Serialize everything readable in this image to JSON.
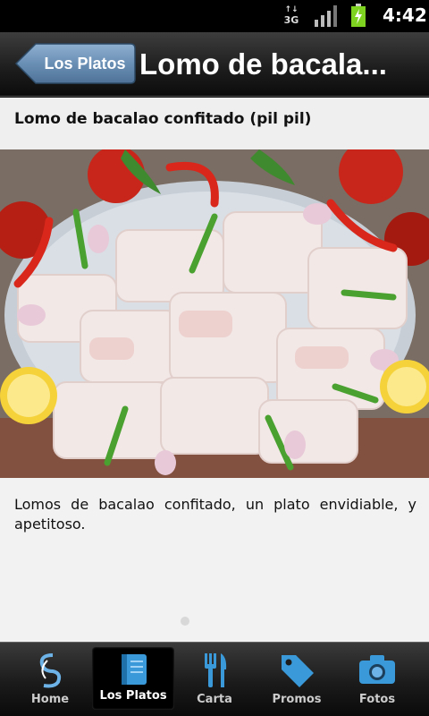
{
  "status_bar": {
    "network": "3G",
    "time": "4:42"
  },
  "header": {
    "back_label": "Los Platos",
    "title": "Lomo de bacala..."
  },
  "dish": {
    "name": "Lomo de bacalao confitado (pil pil)",
    "description": "Lomos de bacalao confitado, un plato envidiable, y apetitoso."
  },
  "tabs": [
    {
      "label": "Home",
      "icon": "logo-icon"
    },
    {
      "label": "Los Platos",
      "icon": "book-icon",
      "active": true
    },
    {
      "label": "Carta",
      "icon": "cutlery-icon"
    },
    {
      "label": "Promos",
      "icon": "tag-icon"
    },
    {
      "label": "Fotos",
      "icon": "camera-icon"
    }
  ],
  "colors": {
    "accent_blue": "#3a9ad9",
    "back_button": "#6a8fb5"
  }
}
